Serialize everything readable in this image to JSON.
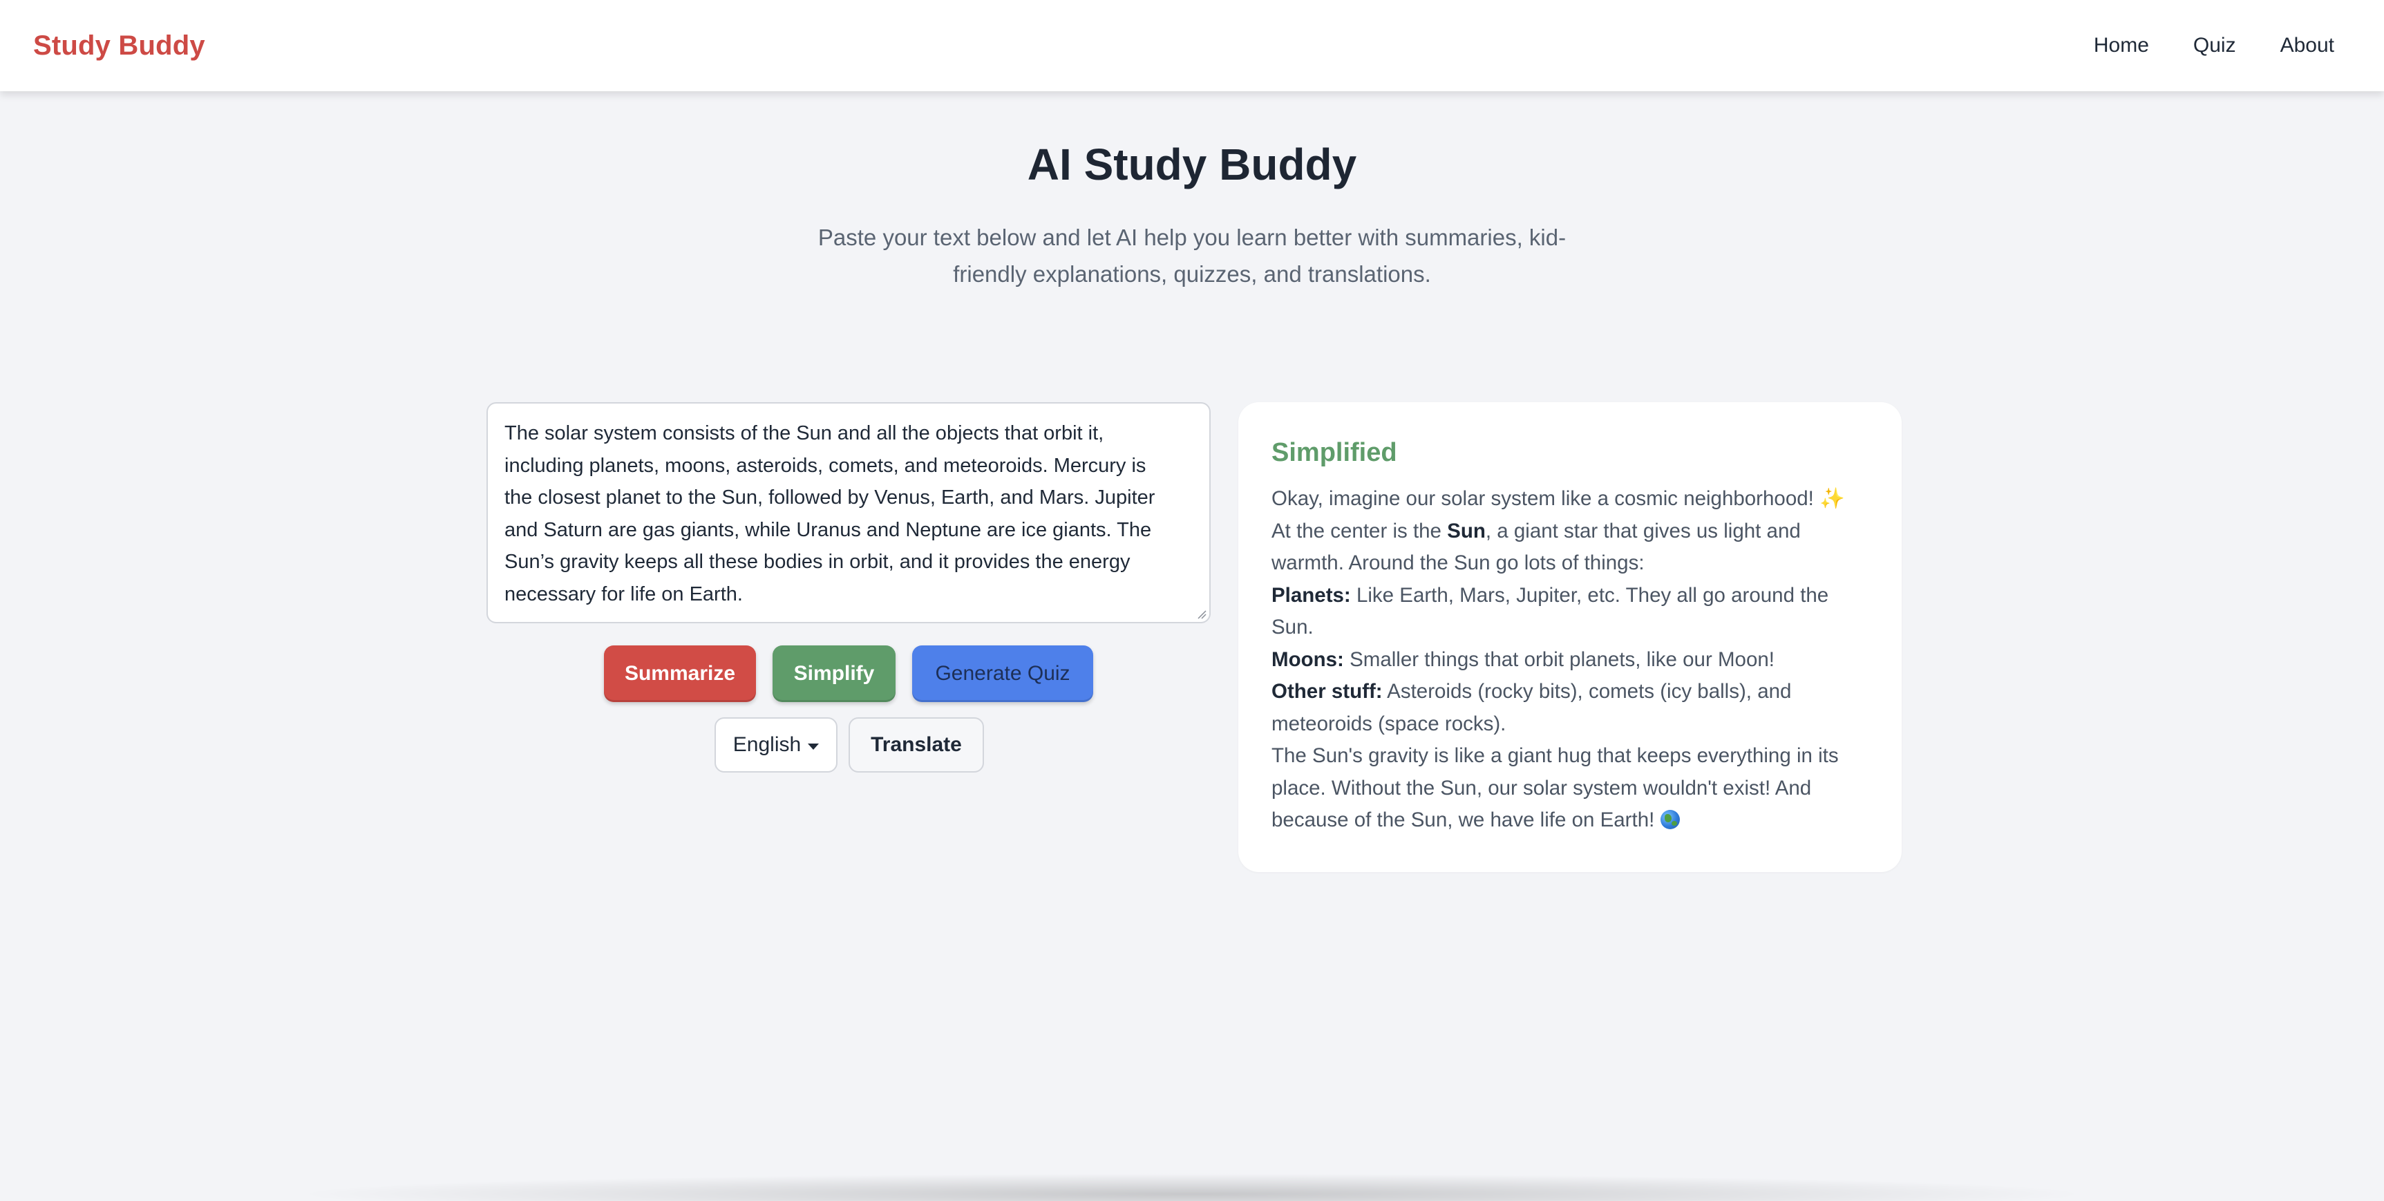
{
  "nav": {
    "brand": "Study Buddy",
    "links": [
      "Home",
      "Quiz",
      "About"
    ]
  },
  "hero": {
    "title": "AI Study Buddy",
    "subtitle_line1": "Paste your text below and let AI help you learn better with summaries, kid-",
    "subtitle_line2": "friendly explanations, quizzes, and translations."
  },
  "input": {
    "lines": [
      "The solar system consists of the Sun and all the objects that orbit it,",
      "including planets, moons, asteroids, comets, and meteoroids. Mercury is",
      "the closest planet to the Sun, followed by Venus, Earth, and Mars. Jupiter",
      "and Saturn are gas giants, while Uranus and Neptune are ice giants. The",
      "Sun’s gravity keeps all these bodies in orbit, and it provides the energy",
      "necessary for life on Earth."
    ]
  },
  "actions": {
    "summarize": "Summarize",
    "simplify": "Simplify",
    "quiz": "Generate Quiz",
    "language": "English",
    "translate": "Translate"
  },
  "result": {
    "title": "Simplified",
    "line1": "Okay, imagine our solar system like a cosmic neighborhood! ",
    "sparkle": "✨",
    "line2_pre": "At the center is the ",
    "line2_bold": "Sun",
    "line2_post": ", a giant star that gives us light and",
    "line3": "warmth. Around the Sun go lots of things:",
    "planets_label": "Planets:",
    "planets_text": " Like Earth, Mars, Jupiter, etc. They all go around the",
    "planets_text2": "Sun.",
    "moons_label": "Moons:",
    "moons_text": " Smaller things that orbit planets, like our Moon!",
    "other_label": "Other stuff:",
    "other_text": " Asteroids (rocky bits), comets (icy balls), and",
    "other_text2": "meteoroids (space rocks).",
    "gravity_line1": "The Sun's gravity is like a giant hug that keeps everything in its",
    "gravity_line2": "place. Without the Sun, our solar system wouldn't exist! And",
    "gravity_line3": "because of the Sun, we have life on Earth! "
  },
  "colors": {
    "brand": "#cd4a45",
    "summarize": "#d14c46",
    "simplify": "#5f9c6a",
    "quiz": "#4e80ea",
    "background": "#f3f4f7"
  }
}
